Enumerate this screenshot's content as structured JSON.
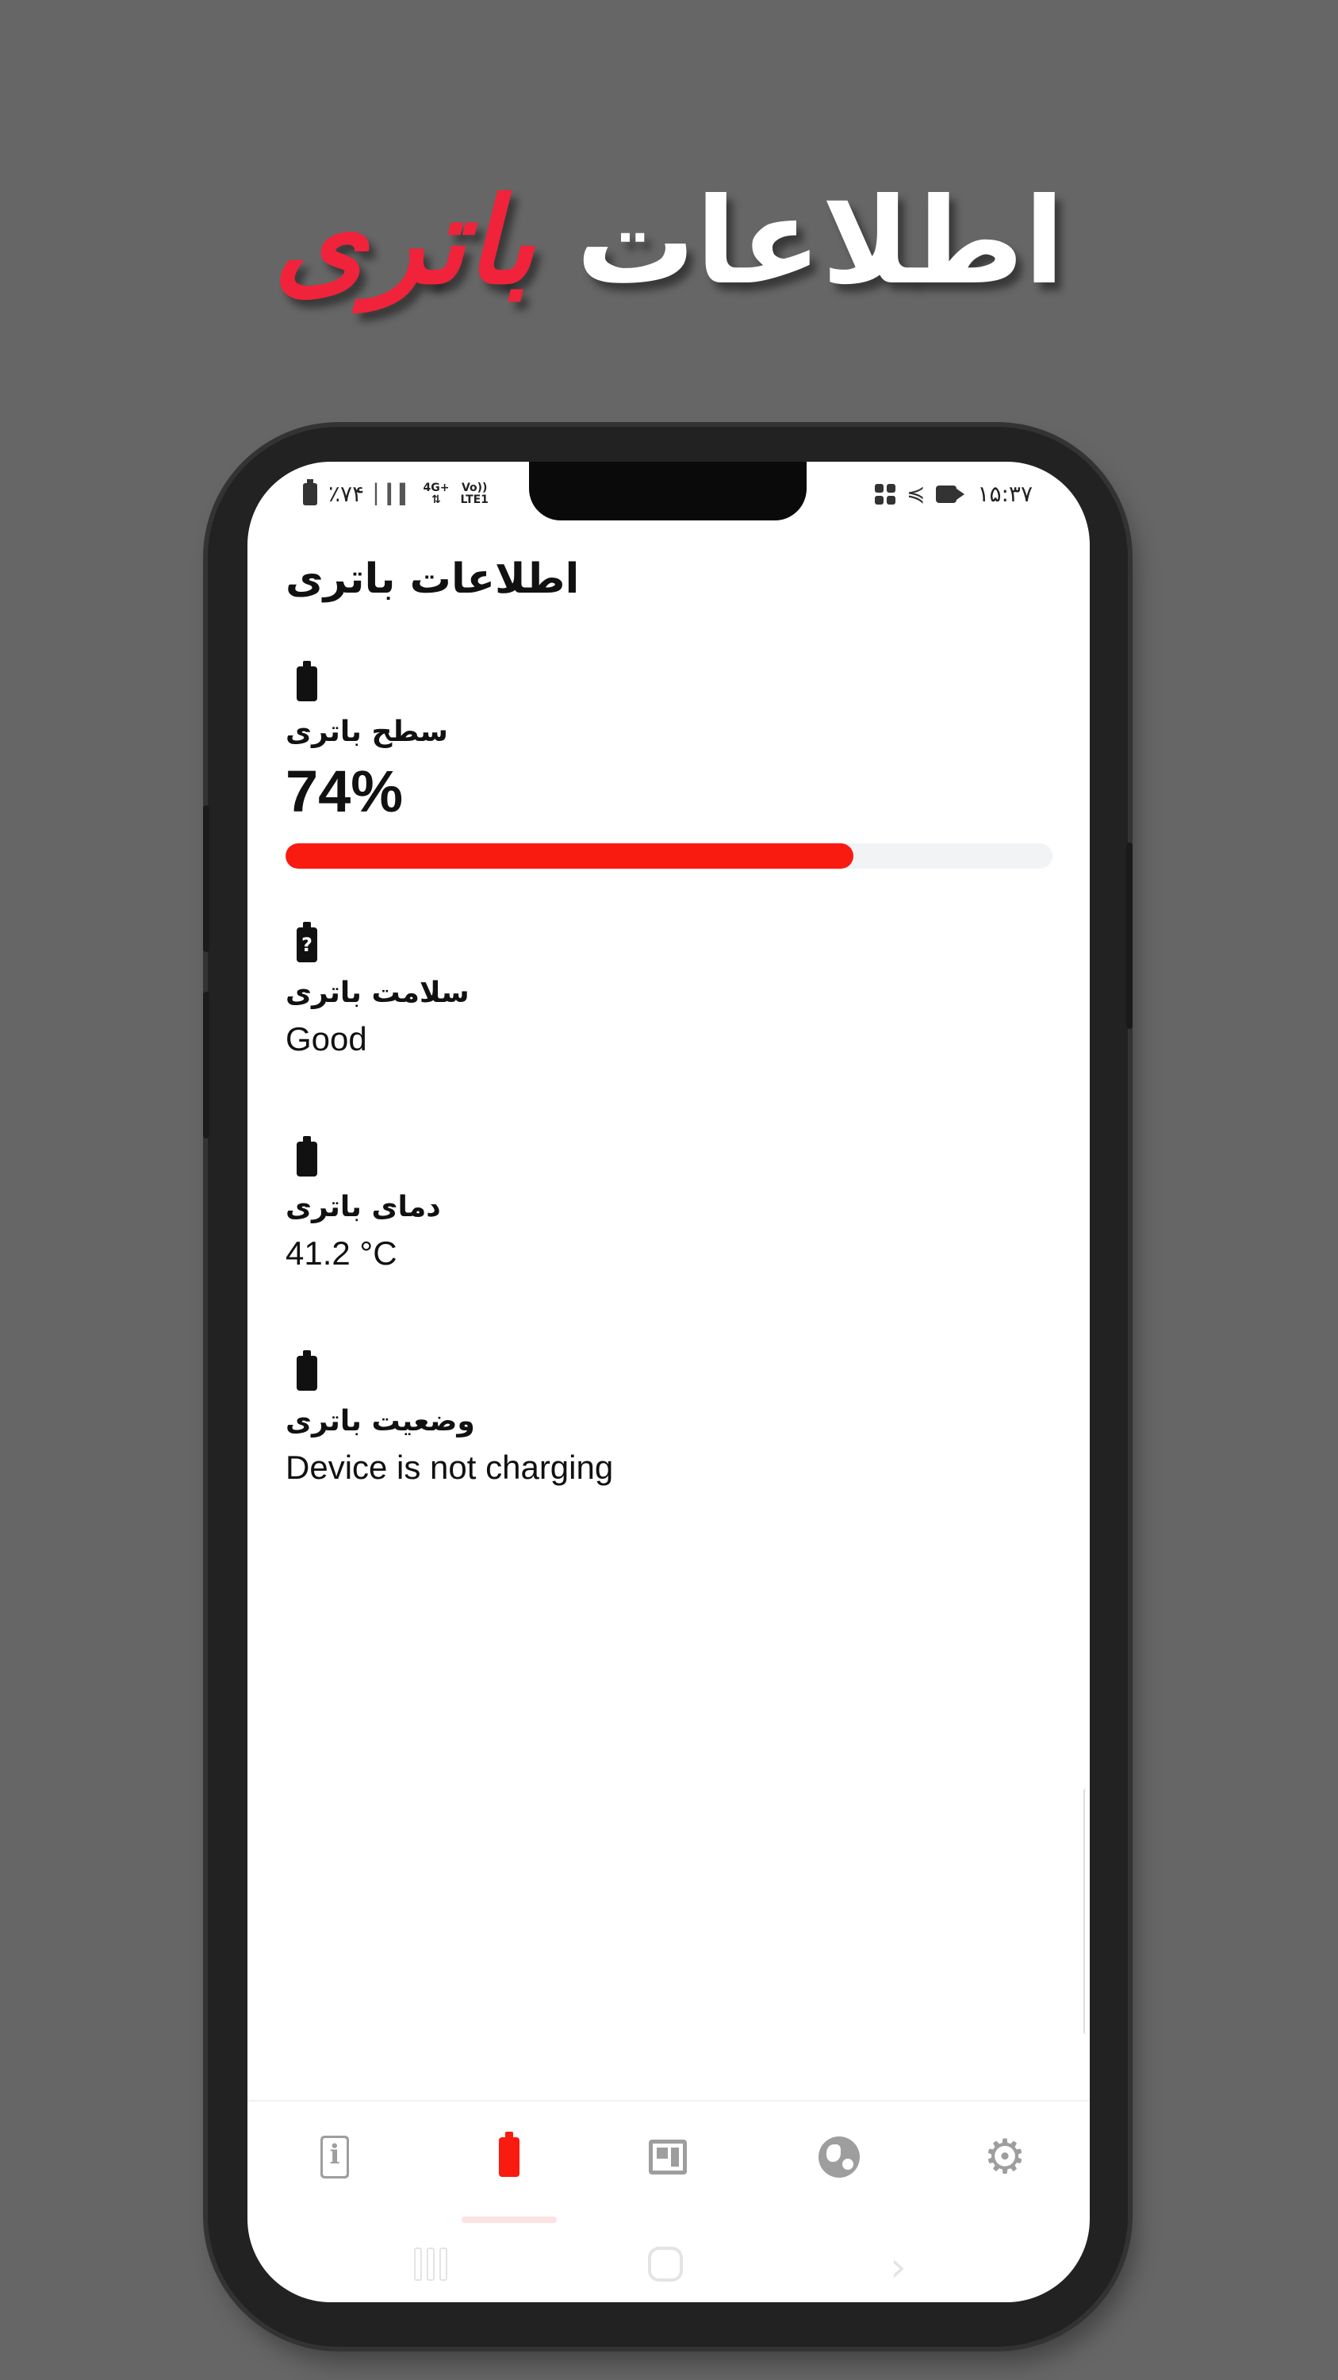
{
  "promo": {
    "word1": "اطلاعات",
    "word2": "باتری"
  },
  "status_bar": {
    "battery_percent": "٪۷۴",
    "network_top": "4G+",
    "network_bottom": "LTE1",
    "volte": "Vo))",
    "time": "۱۵:۳۷"
  },
  "page": {
    "title": "اطلاعات باتری",
    "sections": [
      {
        "label": "سطح باتری",
        "value": "74%",
        "icon": "battery-full-icon"
      },
      {
        "label": "سلامت باتری",
        "value": "Good",
        "icon": "battery-unknown-icon"
      },
      {
        "label": "دمای باتری",
        "value": "41.2 °C",
        "icon": "battery-full-icon"
      },
      {
        "label": "وضعیت باتری",
        "value": "Device is not charging",
        "icon": "battery-full-icon"
      }
    ],
    "battery_level": 0.74
  },
  "colors": {
    "accent": "#fa1b10",
    "promo_accent": "#f0233b",
    "background": "#666666",
    "inactive_icon": "#9e9e9e"
  },
  "bottom_nav": {
    "items": [
      "info-icon",
      "battery-icon",
      "cpu-icon",
      "globe-icon",
      "gear-icon"
    ],
    "selected": "battery-icon"
  }
}
